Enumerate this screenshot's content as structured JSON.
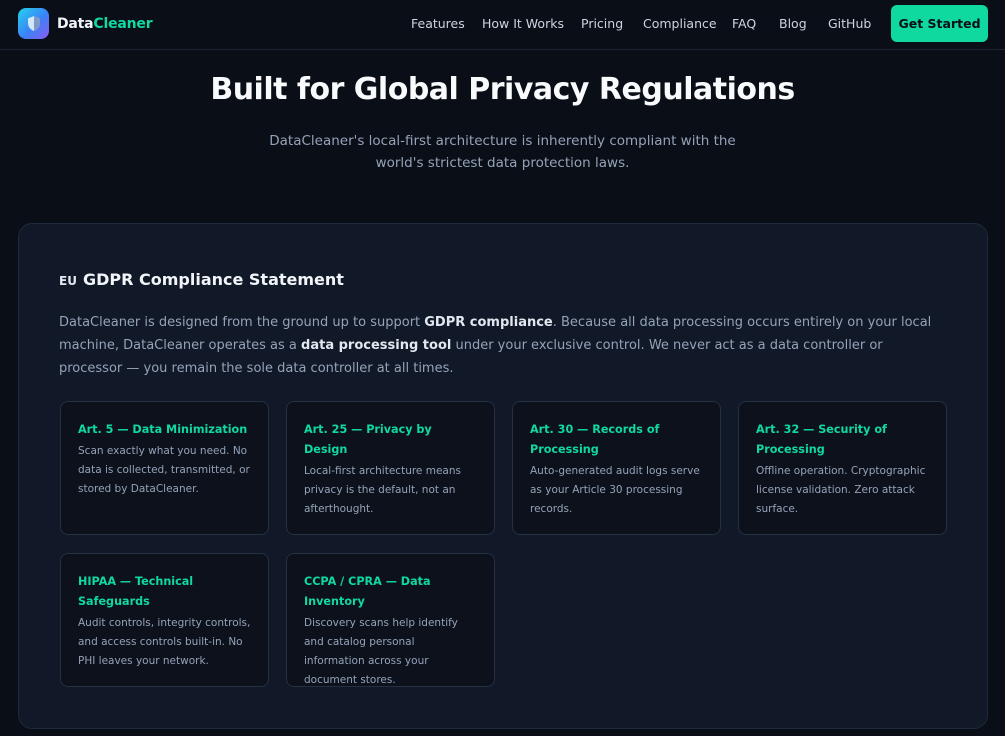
{
  "nav": {
    "brand_part1": "Data",
    "brand_part2": "Cleaner",
    "links": [
      "Features",
      "How It Works",
      "Pricing",
      "Compliance",
      "FAQ",
      "Blog",
      "GitHub"
    ],
    "cta_label": "Get Started"
  },
  "hero": {
    "title": "Built for Global Privacy Regulations",
    "subtitle": "DataCleaner's local-first architecture is inherently compliant with the world's strictest data protection laws."
  },
  "gdpr": {
    "flag_icon": "EU",
    "title": "GDPR Compliance Statement",
    "body_1": "DataCleaner is designed from the ground up to support ",
    "body_strong_1": "GDPR compliance",
    "body_2": ". Because all data processing occurs entirely on your local machine, DataCleaner operates as a ",
    "body_strong_2": "data processing tool",
    "body_3": " under your exclusive control. We never act as a data controller or processor — you remain the sole data controller at all times."
  },
  "cards": [
    {
      "title": "Art. 5 — Data Minimization",
      "desc": "Scan exactly what you need. No data is collected, transmitted, or stored by DataCleaner."
    },
    {
      "title": "Art. 25 — Privacy by Design",
      "desc": "Local-first architecture means privacy is the default, not an afterthought."
    },
    {
      "title": "Art. 30 — Records of Processing",
      "desc": "Auto-generated audit logs serve as your Article 30 processing records."
    },
    {
      "title": "Art. 32 — Security of Processing",
      "desc": "Offline operation. Cryptographic license validation. Zero attack surface."
    },
    {
      "title": "HIPAA — Technical Safeguards",
      "desc": "Audit controls, integrity controls, and access controls built-in. No PHI leaves your network."
    },
    {
      "title": "CCPA / CPRA — Data Inventory",
      "desc": "Discovery scans help identify and catalog personal information across your document stores."
    }
  ],
  "colors": {
    "background": "#0a0e17",
    "panel": "#111827",
    "accent": "#10d9a0"
  }
}
